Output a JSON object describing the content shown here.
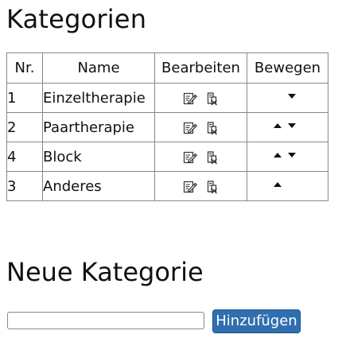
{
  "page": {
    "title": "Kategorien"
  },
  "table": {
    "headers": {
      "nr": "Nr.",
      "name": "Name",
      "edit": "Bearbeiten",
      "move": "Bewegen"
    },
    "rows": [
      {
        "nr": "1",
        "name": "Einzeltherapie",
        "can_move_up": false,
        "can_move_down": true
      },
      {
        "nr": "2",
        "name": "Paartherapie",
        "can_move_up": true,
        "can_move_down": true
      },
      {
        "nr": "4",
        "name": "Block",
        "can_move_up": true,
        "can_move_down": true
      },
      {
        "nr": "3",
        "name": "Anderes",
        "can_move_up": true,
        "can_move_down": false
      }
    ],
    "icons": {
      "edit": "edit-icon",
      "delete": "delete-icon",
      "move_up": "arrow-up-icon",
      "move_down": "arrow-down-icon"
    }
  },
  "new_category": {
    "title": "Neue Kategorie",
    "input_value": "",
    "input_placeholder": "",
    "button_label": "Hinzufügen",
    "button_color": "#2f6fb0"
  }
}
